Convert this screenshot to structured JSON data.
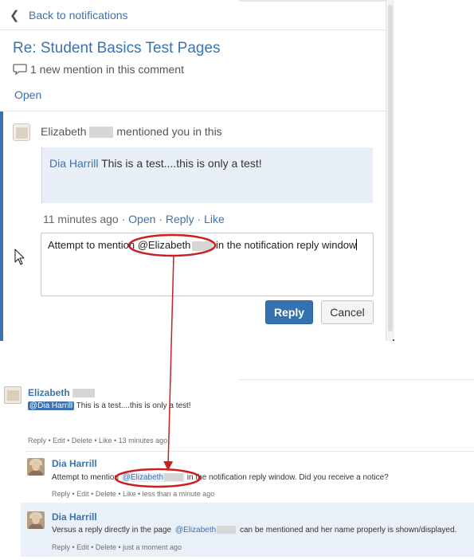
{
  "popup": {
    "back_label": "Back to notifications",
    "title": "Re: Student Basics Test Pages",
    "mention_count_text": "1 new mention in this comment",
    "open_label": "Open",
    "notification": {
      "author_first": "Elizabeth",
      "action_text": "mentioned you in this",
      "quote_mention": "Dia Harrill",
      "quote_text": " This is a test....this is only a test!",
      "time": "11 minutes ago",
      "sep": " · ",
      "open_label": "Open",
      "reply_label": "Reply",
      "like_label": "Like"
    },
    "reply_box": {
      "before": "Attempt to mention ",
      "mention": "@Elizabeth",
      "after": " in the notification reply window"
    },
    "reply_button": "Reply",
    "cancel_button": "Cancel"
  },
  "page_comments": [
    {
      "author": "Elizabeth",
      "mention": "@Dia Harrill",
      "text": " This is a test....this is only a test!",
      "actions": "Reply • Edit • Delete • Like • 13 minutes ago"
    },
    {
      "author": "Dia Harrill",
      "text_before": "Attempt to mention ",
      "mention": "@Elizabeth",
      "text_after": " in the notification reply window. Did you receive a notice?",
      "actions": "Reply • Edit • Delete • Like • less than a minute ago"
    },
    {
      "author": "Dia Harrill",
      "text_before": "Versus a reply directly in the page ",
      "mention": "@Elizabeth",
      "text_after": " can be mentioned and her name properly is shown/displayed.",
      "actions": "Reply • Edit • Delete • just a moment ago"
    }
  ],
  "colors": {
    "link": "#3b73af",
    "primary_button": "#3572b0",
    "annotation": "#cc1f1f",
    "quote_bg": "#e9eff7"
  },
  "icons": [
    "chevron-left-icon",
    "speech-bubble-icon",
    "mouse-cursor-icon"
  ]
}
